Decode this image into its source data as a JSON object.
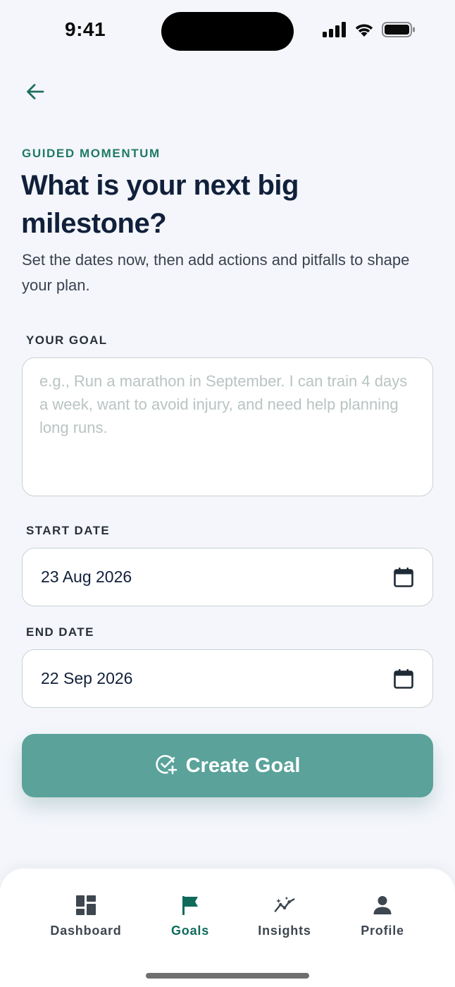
{
  "status_bar": {
    "time": "9:41"
  },
  "header": {
    "eyebrow": "GUIDED MOMENTUM",
    "title": "What is your next big milestone?",
    "subtitle": "Set the dates now, then add actions and pitfalls to shape your plan."
  },
  "form": {
    "goal_label": "YOUR GOAL",
    "goal_value": "",
    "goal_placeholder": "e.g., Run a marathon in September. I can train 4 days a week, want to avoid injury, and need help planning long runs.",
    "start_date_label": "START DATE",
    "start_date_value": "23 Aug 2026",
    "end_date_label": "END DATE",
    "end_date_value": "22 Sep 2026",
    "submit_label": "Create Goal"
  },
  "tab_bar": {
    "items": [
      {
        "label": "Dashboard",
        "icon": "dashboard-icon",
        "active": false
      },
      {
        "label": "Goals",
        "icon": "flag-icon",
        "active": true
      },
      {
        "label": "Insights",
        "icon": "insights-icon",
        "active": false
      },
      {
        "label": "Profile",
        "icon": "person-icon",
        "active": false
      }
    ]
  },
  "colors": {
    "accent": "#1f7a64",
    "button": "#5aa29a",
    "active_tab": "#0f6b5c",
    "background": "#f4f6fb"
  }
}
